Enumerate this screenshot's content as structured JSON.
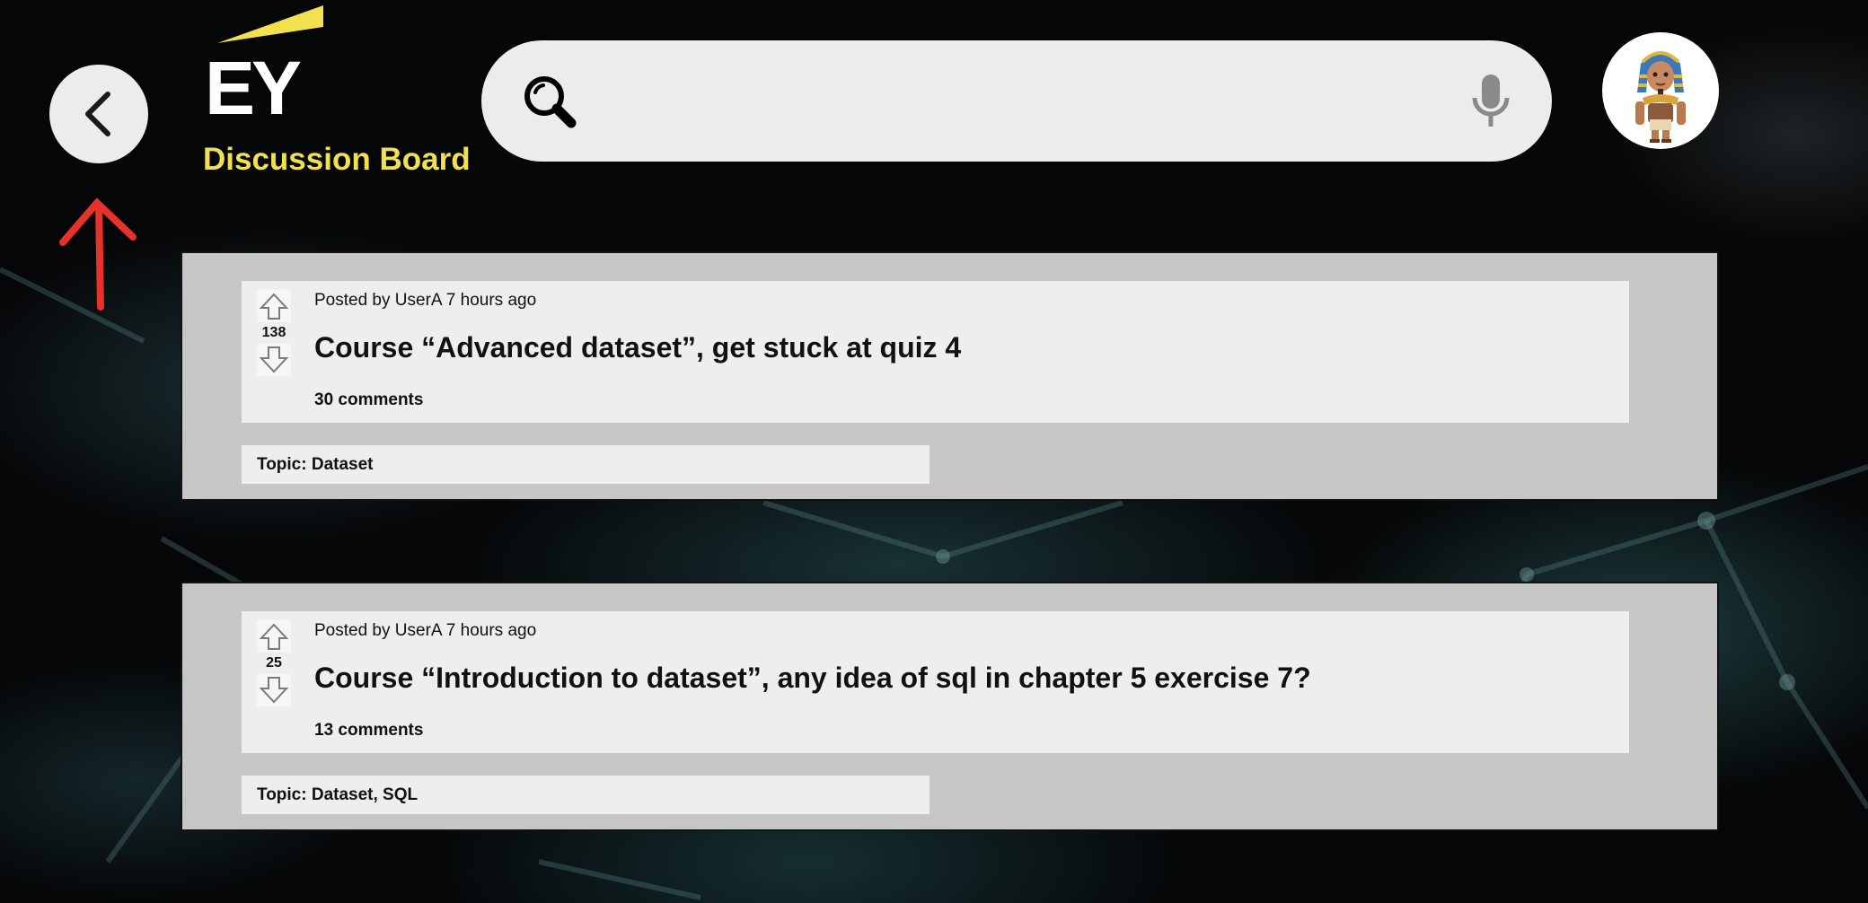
{
  "header": {
    "brand": "EY",
    "app_title": "Discussion Board",
    "brand_color": "#f2e14c",
    "search": {
      "value": "",
      "placeholder": ""
    },
    "icons": {
      "back": "chevron-left-icon",
      "search": "magnifier-icon",
      "mic": "microphone-icon",
      "avatar": "pharaoh-avatar"
    }
  },
  "annotation": {
    "color": "#e8312a",
    "icon": "up-arrow-annotation"
  },
  "posts": [
    {
      "votes": "138",
      "meta": "Posted by UserA 7 hours ago",
      "title": "Course “Advanced dataset”, get stuck at quiz 4",
      "comments": "30 comments",
      "topic": "Topic: Dataset"
    },
    {
      "votes": "25",
      "meta": "Posted by UserA 7 hours ago",
      "title": "Course “Introduction to dataset”, any idea of sql in chapter 5 exercise 7?",
      "comments": "13 comments",
      "topic": "Topic: Dataset, SQL"
    }
  ]
}
